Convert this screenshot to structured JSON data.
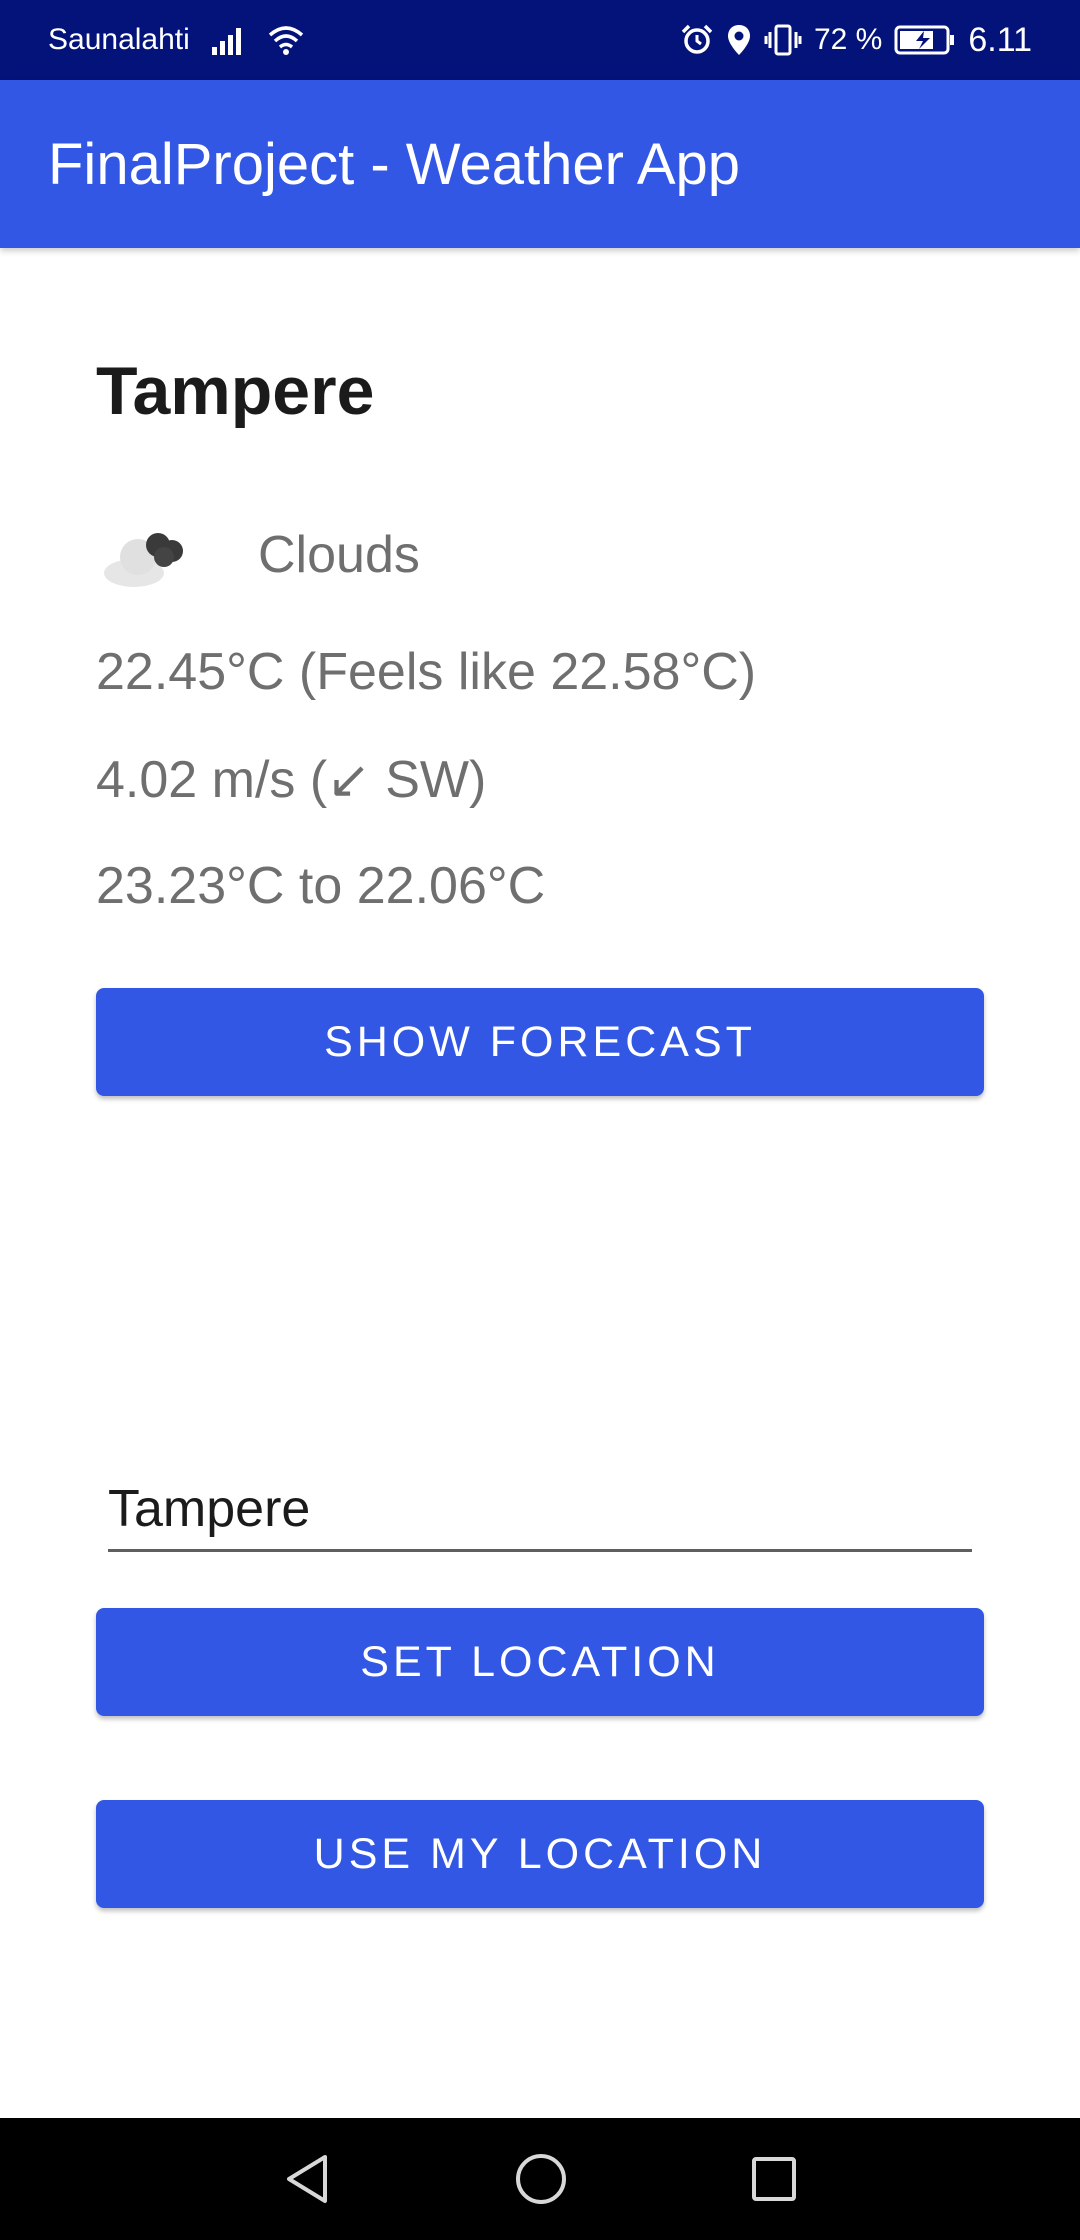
{
  "status_bar": {
    "carrier": "Saunalahti",
    "battery": "72 %",
    "time": "6.11",
    "icons": [
      "signal-icon",
      "wifi-icon",
      "alarm-icon",
      "location-icon",
      "vibrate-icon",
      "battery-icon"
    ]
  },
  "app_bar": {
    "title": "FinalProject - Weather App"
  },
  "weather": {
    "city": "Tampere",
    "condition": "Clouds",
    "condition_icon": "cloud-icon",
    "temperature": "22.45°C (Feels like 22.58°C)",
    "wind": "4.02 m/s (↙ SW)",
    "range": "23.23°C to 22.06°C"
  },
  "buttons": {
    "show_forecast": "SHOW FORECAST",
    "set_location": "SET LOCATION",
    "use_my_location": "USE MY LOCATION"
  },
  "location_input": {
    "value": "Tampere"
  },
  "nav_bar": {
    "icons": [
      "back-icon",
      "home-icon",
      "recents-icon"
    ]
  },
  "colors": {
    "status_bar": "#041379",
    "primary": "#3257E5",
    "text_secondary": "#6f6f6f",
    "text_primary": "#1b1b1b"
  }
}
